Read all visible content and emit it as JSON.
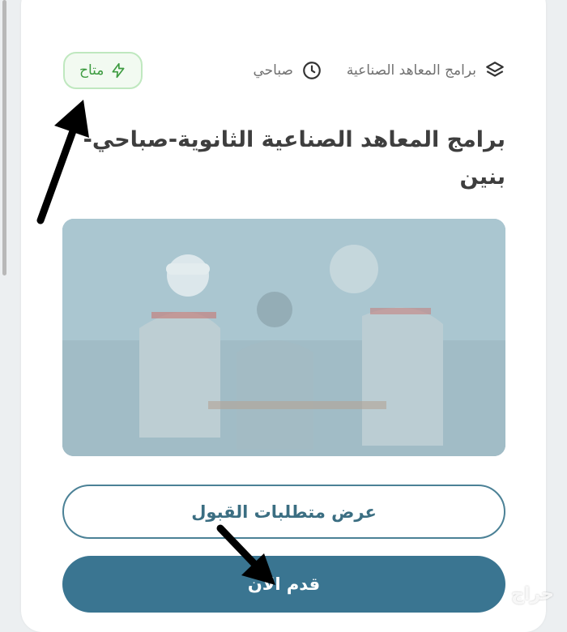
{
  "meta": {
    "category": "برامج المعاهد الصناعية",
    "category_icon": "layers-icon",
    "schedule": "صباحي",
    "schedule_icon": "clock-icon",
    "status": "متاح",
    "status_icon": "lightning-icon"
  },
  "program": {
    "title": "برامج المعاهد الصناعية الثانوية-صباحي-بنين",
    "image_icon": "workshop-photo"
  },
  "actions": {
    "requirements_label": "عرض متطلبات القبول",
    "apply_label": "قدم الآن"
  },
  "watermark": "حراج",
  "colors": {
    "primary": "#3a7591",
    "status_green": "#3d9b40",
    "status_border": "#bfe8bf"
  }
}
